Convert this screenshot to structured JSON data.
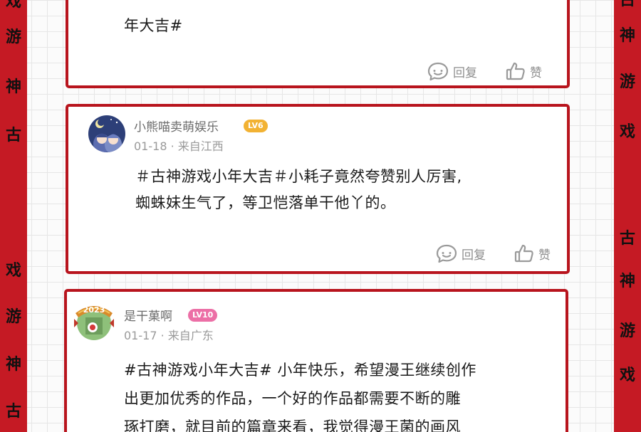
{
  "theme": {
    "accent": "#c51a24",
    "border": "#b8141d",
    "lv6_color": "#f2b233",
    "lv10_color": "#ec6fa6"
  },
  "side_strips": {
    "left": [
      "戏",
      "游",
      "神",
      "古",
      "戏",
      "游",
      "神",
      "古"
    ],
    "right": [
      "古",
      "神",
      "游",
      "戏",
      "古",
      "神",
      "游",
      "戏"
    ]
  },
  "comments": [
    {
      "text_lines": [
        "年大吉#"
      ],
      "reply_label": "回复",
      "like_label": "赞"
    },
    {
      "username": "小熊喵卖萌娱乐",
      "level": "LV6",
      "date": "01-18",
      "location": "来自江西",
      "avatar_icon": "anime-couple-avatar",
      "text_lines": [
        "＃古神游戏小年大吉＃小耗子竟然夸赞别人厉害,",
        "蜘蛛妹生气了，等卫恺落单干他丫的。"
      ],
      "reply_label": "回复",
      "like_label": "赞"
    },
    {
      "username": "是干菓啊",
      "level": "LV10",
      "date": "01-17",
      "location": "来自广东",
      "avatar_icon": "2023-badge-avatar",
      "avatar_text": "2023",
      "text_lines": [
        "#古神游戏小年大吉# 小年快乐，希望漫王继续创作",
        "出更加优秀的作品，一个好的作品都需要不断的雕",
        "琢打磨，就目前的篇章来看，我觉得漫王菌的画风"
      ]
    }
  ]
}
